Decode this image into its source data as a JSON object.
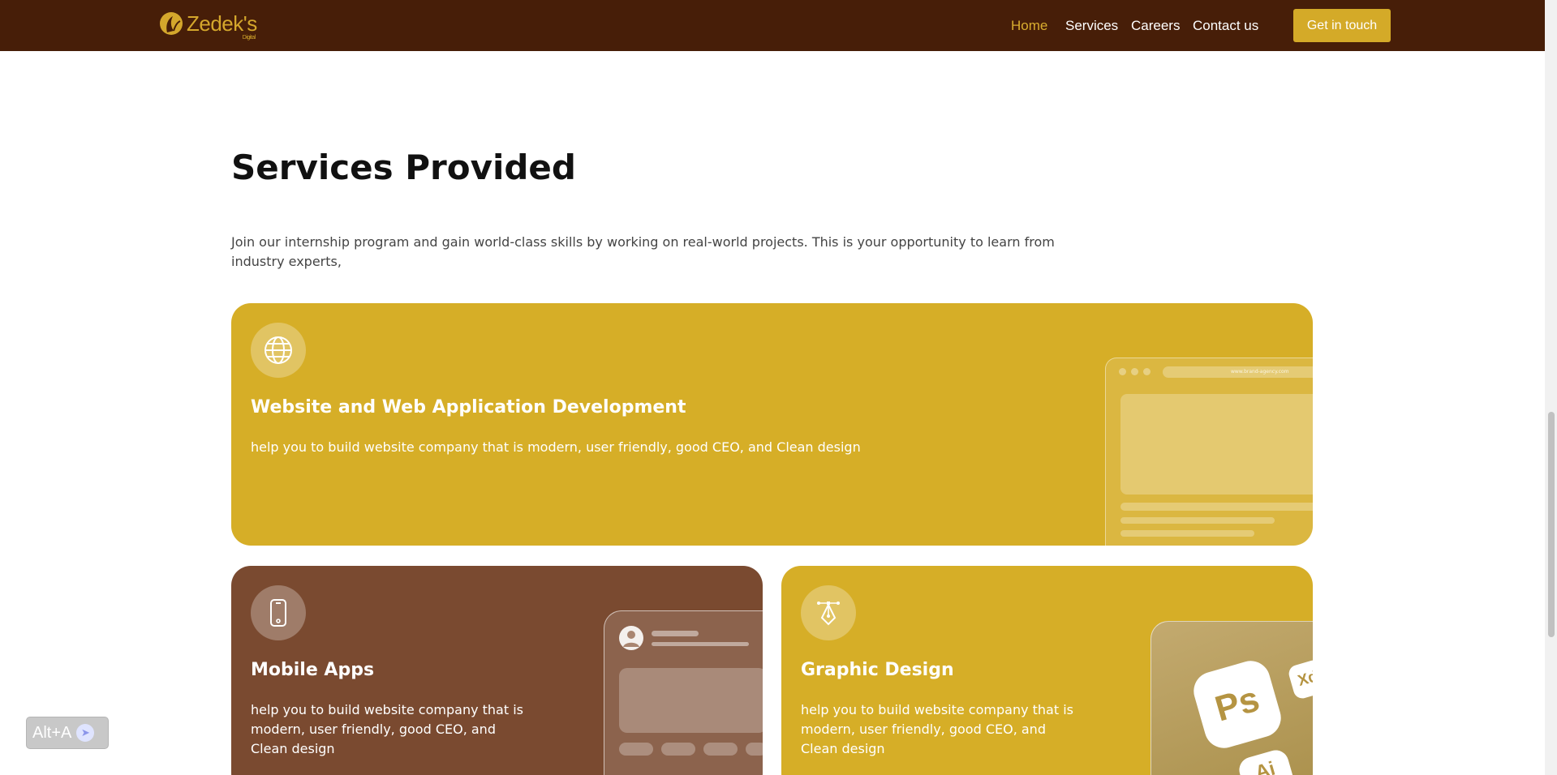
{
  "nav": {
    "logo_text": "Zedek's",
    "logo_sub": "Digital",
    "links": [
      {
        "label": "Home",
        "active": true
      },
      {
        "label": "Services",
        "active": false
      },
      {
        "label": "Careers",
        "active": false
      },
      {
        "label": "Contact us",
        "active": false
      }
    ],
    "cta_label": "Get in touch"
  },
  "section": {
    "title": "Services Provided",
    "description": "Join our internship program and gain world-class skills by working on real-world projects. This is your opportunity to learn from industry experts,"
  },
  "cards": [
    {
      "title": "Website and Web Application Development",
      "description": "help you to build website company that is modern, user friendly, good CEO, and Clean design",
      "icon": "globe-icon",
      "url_text": "www.brand-agency.com"
    },
    {
      "title": "Mobile Apps",
      "description": "help you to build website company that is modern, user friendly, good CEO, and Clean design",
      "icon": "phone-icon"
    },
    {
      "title": "Graphic Design",
      "description": "help you to build website company that is modern, user friendly, good CEO, and Clean design",
      "icon": "pen-tool-icon",
      "app_tiles": [
        "Ps",
        "Xd",
        "Ai"
      ]
    }
  ],
  "shortcut": {
    "label": "Alt+A",
    "icon": "arrow-right-icon"
  },
  "colors": {
    "nav_bg": "#471e08",
    "accent_gold": "#d6ae27",
    "brown_card": "#7a4a30",
    "active_link": "#d9ad2f"
  }
}
